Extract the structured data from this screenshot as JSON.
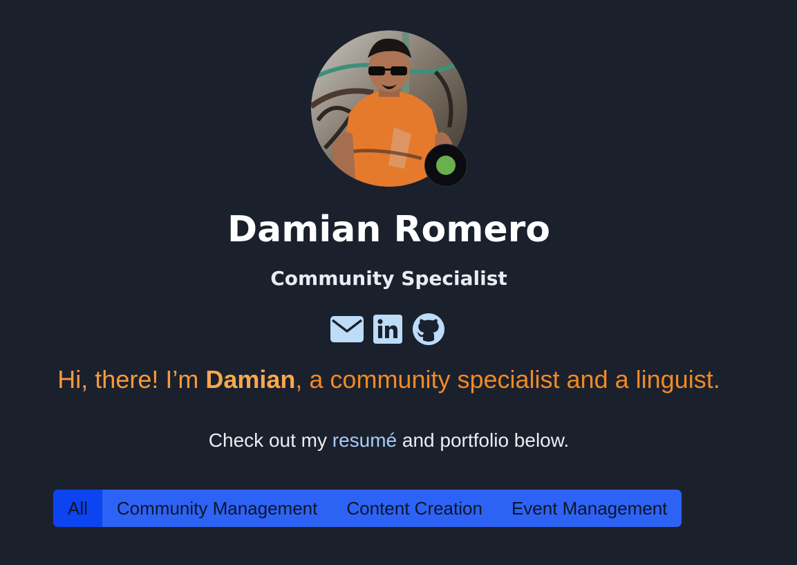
{
  "profile": {
    "name": "Damian Romero",
    "role": "Community Specialist",
    "status_color": "#6ab04c"
  },
  "socials": [
    {
      "icon": "envelope-icon",
      "label": "Email"
    },
    {
      "icon": "linkedin-icon",
      "label": "LinkedIn"
    },
    {
      "icon": "github-icon",
      "label": "GitHub"
    }
  ],
  "intro": {
    "prefix": "Hi, there! I’m ",
    "name": "Damian",
    "suffix": ", a community specialist and a linguist."
  },
  "cta": {
    "prefix": "Check out my ",
    "link_text": "resumé",
    "suffix": " and portfolio below."
  },
  "filters": {
    "items": [
      "All",
      "Community Management",
      "Content Creation",
      "Event Management"
    ],
    "active": "All"
  },
  "colors": {
    "background": "#1b202d",
    "accent_orange": "#f08a24",
    "link": "#a9ccf6",
    "filter_bg": "#2d63f5",
    "filter_active": "#0b44f0"
  }
}
